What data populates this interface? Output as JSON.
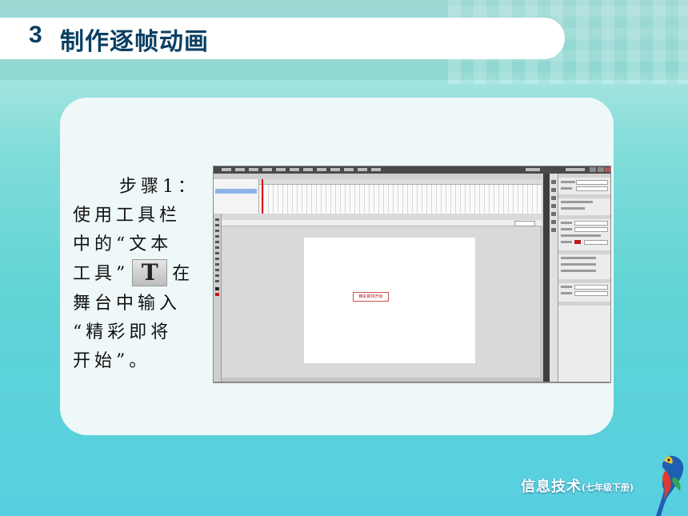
{
  "slide": {
    "section_number": "3",
    "title": "制作逐帧动画"
  },
  "instruction": {
    "lines": [
      "步骤1：",
      "使用工具栏",
      "中的“文本",
      "工具”",
      "在",
      "舞台中输入",
      "“精彩即将",
      "开始”。"
    ],
    "text_tool_icon_label": "T"
  },
  "screenshot": {
    "stage_text": "精彩即将开始",
    "colors": {
      "stage": "#ffffff",
      "text_box_border": "#d05050",
      "fill_swatch": "#c21a1a"
    },
    "icons": [
      "text-tool-icon",
      "selection-tool-icon",
      "fill-color-icon"
    ]
  },
  "logo": {
    "main": "信息技术",
    "sub": "(七年级下册)"
  },
  "colors": {
    "title_text": "#0b3f63",
    "background_top": "#c9ece9",
    "background_bottom": "#58cfe0",
    "card": "#eef8f8"
  }
}
